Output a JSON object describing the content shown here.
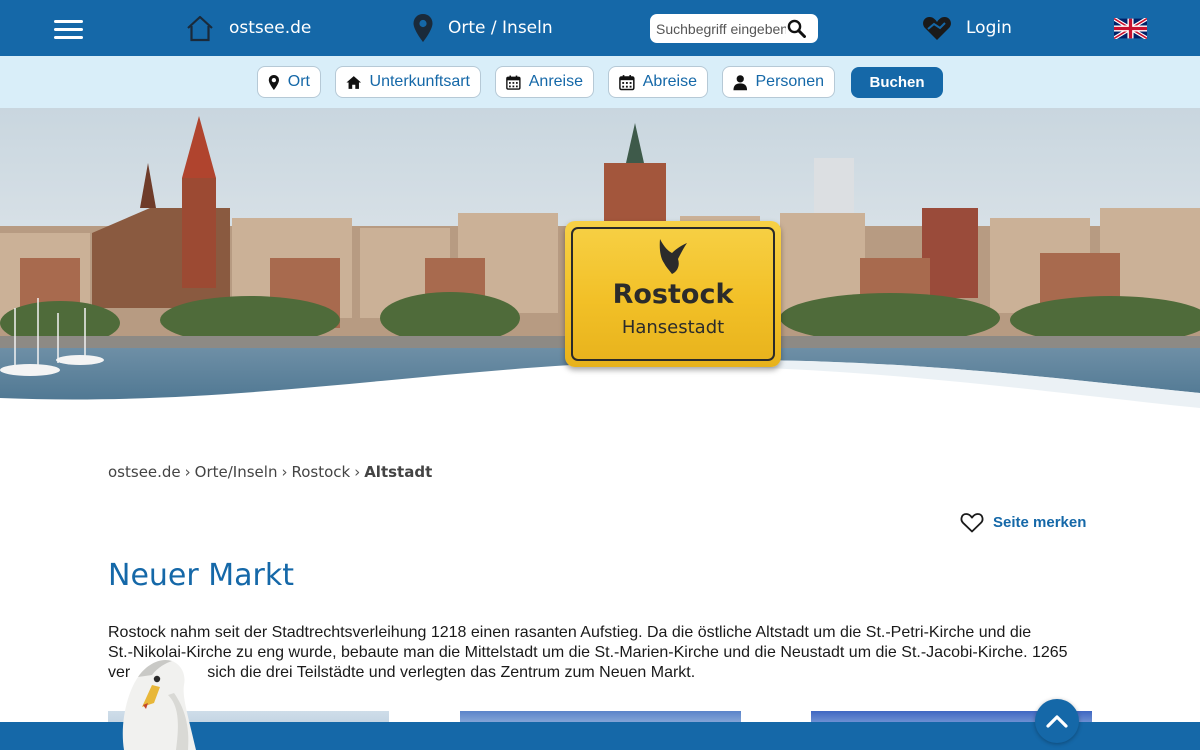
{
  "topnav": {
    "menu_icon": "hamburger-menu-icon",
    "home": {
      "icon": "home-icon",
      "label": "ostsee.de"
    },
    "orte": {
      "icon": "map-pin-icon",
      "label": "Orte / Inseln"
    },
    "search": {
      "placeholder": "Suchbegriff eingeben",
      "icon": "search-icon"
    },
    "login": {
      "icon": "heart-login-icon",
      "label": "Login"
    },
    "language": {
      "icon": "uk-flag-icon"
    }
  },
  "booking": {
    "ort": {
      "icon": "map-pin-icon",
      "label": "Ort"
    },
    "unterkunft": {
      "icon": "house-icon",
      "label": "Unterkunftsart"
    },
    "anreise": {
      "icon": "calendar-icon",
      "label": "Anreise"
    },
    "abreise": {
      "icon": "calendar-icon",
      "label": "Abreise"
    },
    "personen": {
      "icon": "person-icon",
      "label": "Personen"
    },
    "buchen": "Buchen"
  },
  "hero": {
    "sign_title": "Rostock",
    "sign_subtitle": "Hansestadt"
  },
  "breadcrumb": {
    "items": [
      "ostsee.de",
      "Orte/Inseln",
      "Rostock"
    ],
    "current": "Altstadt"
  },
  "bookmark": {
    "icon": "heart-outline-icon",
    "label": "Seite merken"
  },
  "content": {
    "title": "Neuer Markt",
    "line1": "Rostock nahm seit der Stadtrechtsverleihung 1218 einen rasanten Aufstieg. Da die östliche Altstadt um die St.-Petri-Kirche und die",
    "line2": "St.-Nikolai-Kirche zu eng wurde, bebaute man die Mittelstadt um die St.-Marien-Kirche und die Neustadt um die St.-Jacobi-Kirche. 1265",
    "line3a": "ver",
    "line3b": "sich die drei Teilstädte und verlegten das Zentrum zum Neuen Markt."
  },
  "colors": {
    "primary": "#1568a8",
    "booking_bar": "#d9eef9",
    "sign_yellow": "#f2c027"
  }
}
